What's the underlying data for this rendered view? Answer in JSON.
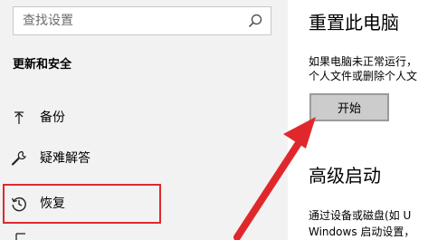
{
  "sidebar": {
    "search": {
      "placeholder": "查找设置"
    },
    "section_title": "更新和安全",
    "items": [
      {
        "label": "备份",
        "icon": "backup-arrow-icon"
      },
      {
        "label": "疑难解答",
        "icon": "wrench-icon"
      },
      {
        "label": "恢复",
        "icon": "history-icon",
        "selected": true
      }
    ]
  },
  "content": {
    "reset_title": "重置此电脑",
    "reset_desc_line1": "如果电脑未正常运行，",
    "reset_desc_line2": "个人文件或删除个人文",
    "start_button": "开始",
    "advanced_title": "高级启动",
    "advanced_desc_line1": "通过设备或磁盘(如 U",
    "advanced_desc_line2": "Windows 启动设置，"
  },
  "annotations": {
    "highlight_color": "#e0282c",
    "arrow_color": "#e0282c"
  }
}
